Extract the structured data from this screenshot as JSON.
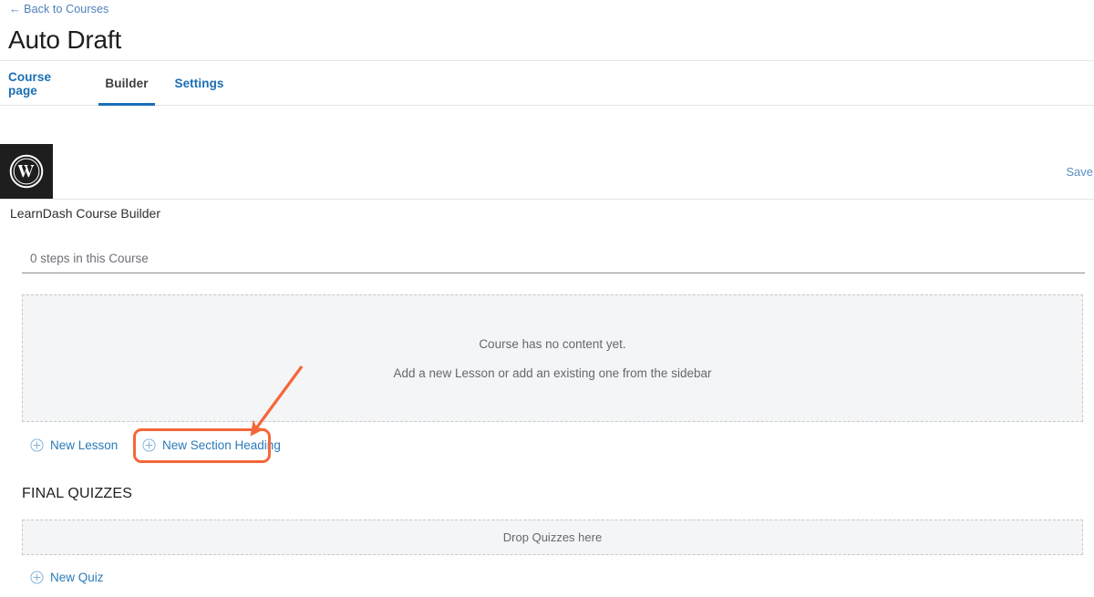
{
  "header": {
    "back_link": "← Back to Courses",
    "title": "Auto Draft"
  },
  "tabs": [
    {
      "label": "Course page",
      "active": false
    },
    {
      "label": "Builder",
      "active": true
    },
    {
      "label": "Settings",
      "active": false
    }
  ],
  "toolbar": {
    "logo_icon": "wordpress-logo-icon",
    "save_label": "Save"
  },
  "builder": {
    "heading": "LearnDash Course Builder",
    "steps_count": "0 steps in this Course",
    "empty_state": {
      "line1": "Course has no content yet.",
      "line2": "Add a new Lesson or add an existing one from the sidebar"
    },
    "actions": {
      "new_lesson": "New Lesson",
      "new_section_heading": "New Section Heading",
      "plus_icon": "plus-circle-icon"
    }
  },
  "final_quizzes": {
    "title": "FINAL QUIZZES",
    "dropzone_label": "Drop Quizzes here",
    "new_quiz": "New Quiz"
  },
  "annotation": {
    "arrow_icon": "arrow-pointer-icon",
    "highlight_target": "New Section Heading",
    "color": "#f4673a"
  },
  "colors": {
    "link_blue": "#2a7bb9",
    "tab_active_underline": "#1a70b8",
    "annotation_orange": "#f4673a",
    "dropzone_bg": "#f3f5f6",
    "logo_bg": "#1e1e1e"
  }
}
